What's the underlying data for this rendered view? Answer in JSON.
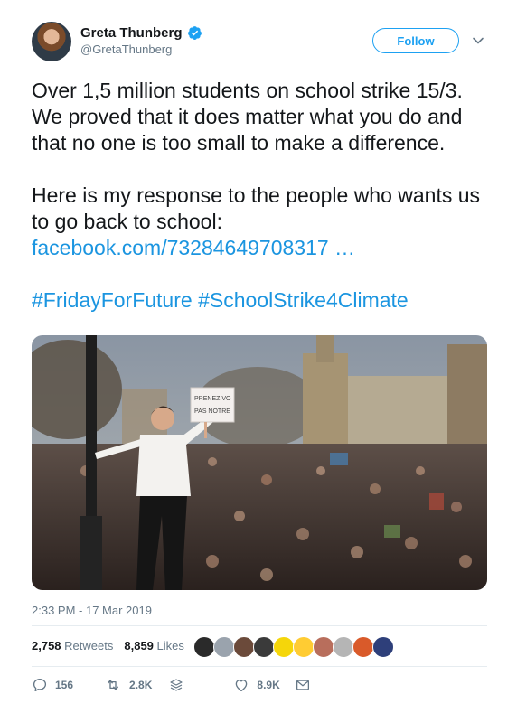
{
  "author": {
    "display_name": "Greta Thunberg",
    "handle": "@GretaThunberg",
    "verified_icon": "verified-badge-icon"
  },
  "follow_label": "Follow",
  "tweet": {
    "paragraph1": "Over 1,5 million students on school strike 15/3. We proved that it does matter what you do and that no one is too small to make a difference.",
    "paragraph2_text": "Here is my response to the people who wants us to go back to school:",
    "paragraph2_link": "facebook.com/73284649708317 …",
    "hashtag1": "#FridayForFuture",
    "hashtag2": "#SchoolStrike4Climate"
  },
  "photo": {
    "sign_line1": "PRENEZ VO",
    "sign_line2": "PAS NOTRE"
  },
  "timestamp": "2:33 PM - 17 Mar 2019",
  "stats": {
    "retweets_count": "2,758",
    "retweets_label": "Retweets",
    "likes_count": "8,859",
    "likes_label": "Likes"
  },
  "actions": {
    "replies": "156",
    "retweets": "2.8K",
    "likes": "8.9K"
  },
  "colors": {
    "accent": "#1da1f2",
    "link": "#1b95e0",
    "muted": "#657786",
    "text": "#14171a",
    "divider": "#e6ecf0"
  }
}
